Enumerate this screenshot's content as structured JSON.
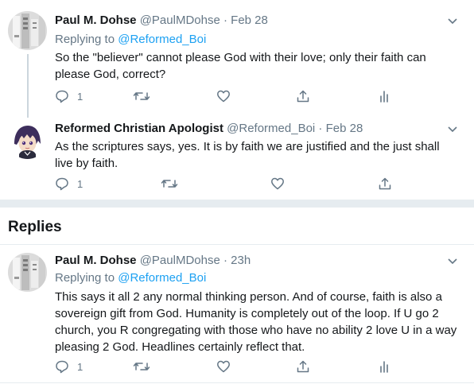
{
  "tweets": [
    {
      "name": "Paul M. Dohse",
      "handle": "@PaulMDohse",
      "separator": "·",
      "date": "Feb 28",
      "replying_label": "Replying to ",
      "replying_to": "@Reformed_Boi",
      "text": "So the \"believer\" cannot please God with their love; only their faith can please God, correct?",
      "reply_count": "1",
      "avatar_icon": "grayscale-profile-photo"
    },
    {
      "name": "Reformed Christian Apologist",
      "handle": "@Reformed_Boi",
      "separator": "·",
      "date": "Feb 28",
      "text": "As the scriptures says, yes. It is by faith we are justified and the just shall live by faith.",
      "reply_count": "1",
      "avatar_icon": "anime-character-avatar"
    }
  ],
  "replies_section": {
    "title": "Replies"
  },
  "replies": [
    {
      "name": "Paul M. Dohse",
      "handle": "@PaulMDohse",
      "separator": "·",
      "date": "23h",
      "replying_label": "Replying to ",
      "replying_to": "@Reformed_Boi",
      "text": "This says it all 2 any normal thinking person. And of course, faith is also a sovereign gift from God. Humanity is completely out of the loop. If U go 2 church, you R congregating with those who have no ability 2 love U in a way pleasing 2 God. Headlines certainly reflect that.",
      "reply_count": "1",
      "avatar_icon": "grayscale-profile-photo"
    }
  ],
  "colors": {
    "link": "#1da1f2",
    "muted": "#657786",
    "text": "#14171a",
    "divider": "#e6ecf0",
    "thread_line": "#ccd6dd"
  },
  "icons": {
    "reply": "reply-icon",
    "retweet": "retweet-icon",
    "like": "heart-icon",
    "share": "share-icon",
    "analytics": "analytics-icon",
    "more": "chevron-down-icon"
  }
}
